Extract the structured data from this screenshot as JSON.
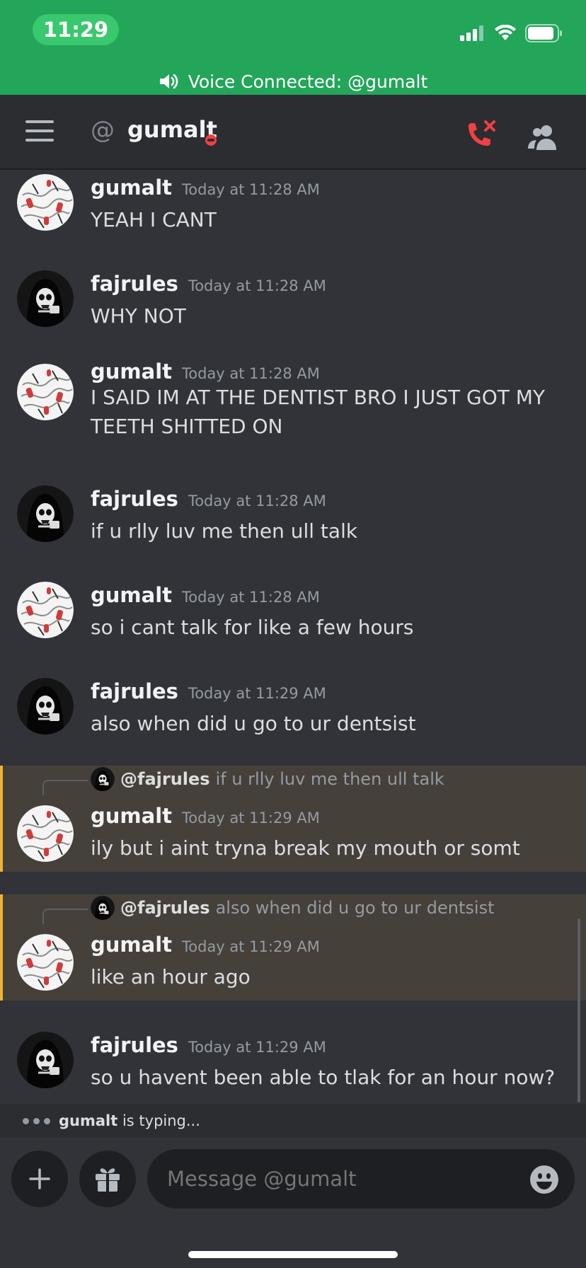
{
  "status_bar": {
    "time": "11:29"
  },
  "voice_banner": {
    "text": "Voice Connected: @gumalt"
  },
  "header": {
    "at_symbol": "@",
    "dm_name": "gumalt"
  },
  "messages": [
    {
      "author": "gumalt",
      "timestamp": "Today at 11:28 AM",
      "text": "YEAH I CANT"
    },
    {
      "author": "fajrules",
      "timestamp": "Today at 11:28 AM",
      "text": "WHY NOT"
    },
    {
      "author": "gumalt",
      "timestamp": "Today at 11:28 AM",
      "text": "I SAID IM AT THE DENTIST BRO I JUST GOT MY TEETH SHITTED ON"
    },
    {
      "author": "fajrules",
      "timestamp": "Today at 11:28 AM",
      "text": "if u rlly luv me then ull talk"
    },
    {
      "author": "gumalt",
      "timestamp": "Today at 11:28 AM",
      "text": "so i cant talk for like a few hours"
    },
    {
      "author": "fajrules",
      "timestamp": "Today at 11:29 AM",
      "text": "also when did u go to ur dentsist"
    },
    {
      "author": "gumalt",
      "timestamp": "Today at 11:29 AM",
      "text": "ily but i aint tryna break my mouth or somt",
      "reply_to": {
        "user": "@fajrules",
        "text": "if u rlly luv me then ull talk"
      }
    },
    {
      "author": "gumalt",
      "timestamp": "Today at 11:29 AM",
      "text": "like an hour ago",
      "reply_to": {
        "user": "@fajrules",
        "text": "also when did u go to ur dentsist"
      }
    },
    {
      "author": "fajrules",
      "timestamp": "Today at 11:29 AM",
      "text": "so u havent been able to tlak for an hour now?"
    }
  ],
  "typing": {
    "user": "gumalt",
    "suffix": " is typing..."
  },
  "composer": {
    "placeholder": "Message @gumalt"
  },
  "colors": {
    "status_bar": "#23a55a",
    "background": "#313338",
    "header": "#2b2d31",
    "reply_highlight": "#45403a",
    "reply_bar": "#f0b232",
    "dnd": "#f23f43",
    "call_red": "#f23f43"
  },
  "icons": {
    "signal": "signal-icon",
    "wifi": "wifi-icon",
    "battery": "battery-icon",
    "speaker": "speaker-icon",
    "menu": "hamburger-icon",
    "call": "phone-hangup-icon",
    "members": "members-icon",
    "plus": "plus-icon",
    "gift": "gift-icon",
    "emoji": "emoji-icon"
  }
}
